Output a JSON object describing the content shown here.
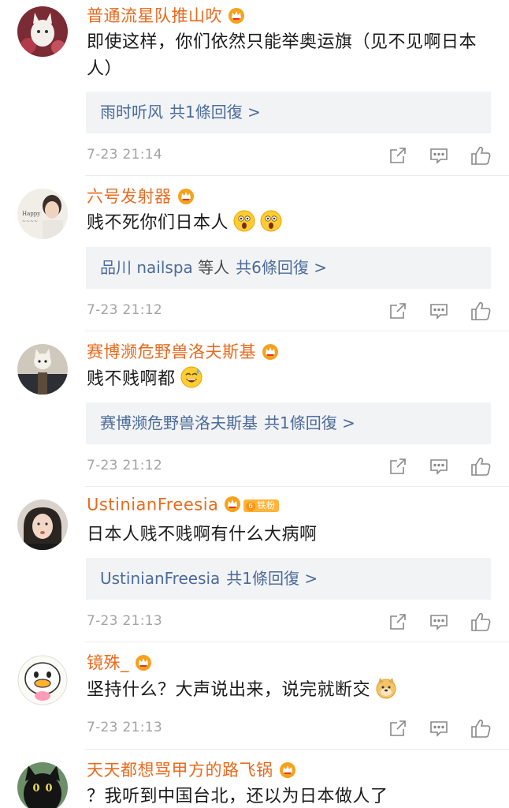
{
  "comments": [
    {
      "username": "普通流星队推山吹",
      "text": "即使这样，你们依然只能举奥运旗（见不见啊日本人）",
      "reply": {
        "user": "雨时听风",
        "mid": "",
        "count": "共1條回復 >"
      },
      "time": "7-23 21:14"
    },
    {
      "username": "六号发射器",
      "text": "贱不死你们日本人",
      "emojis": [
        "surprised-emoji",
        "surprised-emoji"
      ],
      "reply": {
        "user": "品川 nailspa",
        "mid": "等人",
        "count": "共6條回復 >"
      },
      "time": "7-23 21:12"
    },
    {
      "username": "赛博濒危野兽洛夫斯基",
      "text": "贱不贱啊都",
      "emojis": [
        "sweat-smile-emoji"
      ],
      "reply": {
        "user": "赛博濒危野兽洛夫斯基",
        "mid": "",
        "count": "共1條回復 >"
      },
      "time": "7-23 21:12"
    },
    {
      "username": "UstinianFreesia",
      "badge": "铁粉",
      "badge_level": "6",
      "text": "日本人贱不贱啊有什么大病啊",
      "reply": {
        "user": "UstinianFreesia",
        "mid": "",
        "count": "共1條回復 >"
      },
      "time": "7-23 21:13"
    },
    {
      "username": "镜殊_",
      "text": "坚持什么？大声说出来，说完就断交",
      "emojis": [
        "doge-emoji"
      ],
      "time": "7-23 21:13"
    },
    {
      "username": "天天都想骂甲方的路飞锅",
      "text": "？我听到中国台北，还以为日本做人了"
    }
  ],
  "icons": {
    "share": "share-icon",
    "comment": "comment-icon",
    "like": "thumbs-up-icon",
    "crown": "vip-crown-icon"
  },
  "colors": {
    "username": "#e86b1f",
    "reply_link": "#4b6b9a",
    "reply_bg": "#f2f3f5",
    "meta": "#a3a3a3"
  }
}
